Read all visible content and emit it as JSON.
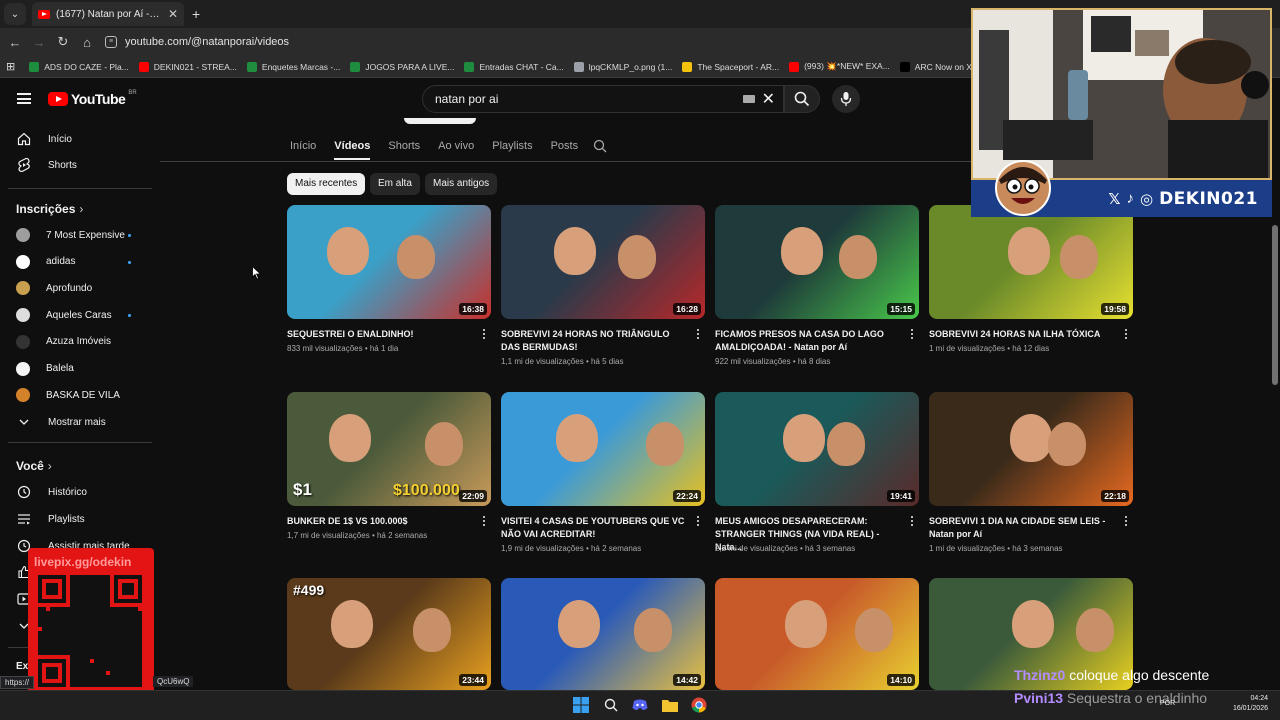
{
  "browser": {
    "tab_title": "(1677) Natan por Aí - YouTube",
    "url": "youtube.com/@natanporai/videos",
    "bookmarks": [
      {
        "label": "ADS DO CAZE - Pla...",
        "color": "#1e8e3e"
      },
      {
        "label": "DEKIN021 - STREA...",
        "color": "#ff0000"
      },
      {
        "label": "Enquetes Marcas -...",
        "color": "#1e8e3e"
      },
      {
        "label": "JOGOS PARA A LIVE...",
        "color": "#1e8e3e"
      },
      {
        "label": "Entradas CHAT - Ca...",
        "color": "#1e8e3e"
      },
      {
        "label": "lpqCKMLP_o.png (1...",
        "color": "#9aa0a6"
      },
      {
        "label": "The Spaceport - AR...",
        "color": "#f4c20d"
      },
      {
        "label": "(993) 💥*NEW* EXA...",
        "color": "#ff0000"
      },
      {
        "label": "ARC Now on X: \"Co...",
        "color": "#000000"
      }
    ]
  },
  "header": {
    "logo_text": "YouTube",
    "logo_region": "BR",
    "search_value": "natan por ai"
  },
  "sidebar": {
    "top_items": [
      {
        "label": "Início",
        "icon": "home-icon"
      },
      {
        "label": "Shorts",
        "icon": "shorts-icon"
      }
    ],
    "subscriptions_heading": "Inscrições",
    "subscriptions": [
      {
        "label": "7 Most Expensive",
        "color": "#9e9e9e",
        "new": true
      },
      {
        "label": "adidas",
        "color": "#ffffff",
        "new": true
      },
      {
        "label": "Aprofundo",
        "color": "#c8a050",
        "new": false
      },
      {
        "label": "Aqueles Caras",
        "color": "#dddddd",
        "new": true
      },
      {
        "label": "Azuza Imóveis",
        "color": "#333333",
        "new": false
      },
      {
        "label": "Balela",
        "color": "#f5f5f5",
        "new": false
      },
      {
        "label": "BASKA DE VILA",
        "color": "#d4822a",
        "new": false
      }
    ],
    "show_more": "Mostrar mais",
    "you_heading": "Você",
    "you_items": [
      {
        "label": "Histórico",
        "icon": "history-icon"
      },
      {
        "label": "Playlists",
        "icon": "playlists-icon"
      },
      {
        "label": "Assistir mais tarde",
        "icon": "watch-later-icon"
      }
    ],
    "bottom_partial": "Ex"
  },
  "channel": {
    "tabs": [
      "Início",
      "Vídeos",
      "Shorts",
      "Ao vivo",
      "Playlists",
      "Posts"
    ],
    "active_tab": "Vídeos",
    "chips": [
      "Mais recentes",
      "Em alta",
      "Mais antigos"
    ],
    "active_chip": "Mais recentes"
  },
  "videos": [
    {
      "title": "SEQUESTREI O ENALDINHO!",
      "views": "833 mil visualizações",
      "age": "há 1 dia",
      "duration": "16:38",
      "colors": [
        "#3aa0c8",
        "#c8302a"
      ]
    },
    {
      "title": "SOBREVIVI 24 HORAS NO TRIÂNGULO DAS BERMUDAS!",
      "views": "1,1 mi de visualizações",
      "age": "há 5 dias",
      "duration": "16:28",
      "colors": [
        "#2a3a4a",
        "#b8282a"
      ]
    },
    {
      "title": "FICAMOS PRESOS NA CASA DO LAGO AMALDIÇOADA! - Natan por Aí",
      "views": "922 mil visualizações",
      "age": "há 8 dias",
      "duration": "15:15",
      "colors": [
        "#1e3a3a",
        "#49c84a"
      ]
    },
    {
      "title": "SOBREVIVI 24 HORAS NA ILHA TÓXICA",
      "views": "1 mi de visualizações",
      "age": "há 12 dias",
      "duration": "19:58",
      "colors": [
        "#6a8a2a",
        "#e8e030"
      ]
    },
    {
      "title": "BUNKER DE 1$ VS 100.000$",
      "views": "1,7 mi de visualizações",
      "age": "há 2 semanas",
      "duration": "22:09",
      "colors": [
        "#4a5a3a",
        "#c89a5a"
      ],
      "label_left": "$1",
      "label_right": "$100.000"
    },
    {
      "title": "VISITEI 4 CASAS DE YOUTUBERS QUE VC NÃO VAI ACREDITAR!",
      "views": "1,9 mi de visualizações",
      "age": "há 2 semanas",
      "duration": "22:24",
      "colors": [
        "#3a9ad8",
        "#e8c020"
      ]
    },
    {
      "title": "MEUS AMIGOS DESAPARECERAM: STRANGER THINGS (NA VIDA REAL) - Nata...",
      "views": "2,2 mi de visualizações",
      "age": "há 3 semanas",
      "duration": "19:41",
      "colors": [
        "#1a5a5a",
        "#5a2a2a"
      ]
    },
    {
      "title": "SOBREVIVI 1 DIA NA CIDADE SEM LEIS - Natan por Aí",
      "views": "1 mi de visualizações",
      "age": "há 3 semanas",
      "duration": "22:18",
      "colors": [
        "#3a2a1a",
        "#e86a20"
      ]
    },
    {
      "title": "",
      "views": "",
      "age": "",
      "duration": "23:44",
      "colors": [
        "#5a3a1a",
        "#e8a020"
      ],
      "label_left": "#499"
    },
    {
      "title": "",
      "views": "",
      "age": "",
      "duration": "14:42",
      "colors": [
        "#2a5ab8",
        "#e8c040"
      ]
    },
    {
      "title": "",
      "views": "",
      "age": "",
      "duration": "14:10",
      "colors": [
        "#c85a2a",
        "#e8d030"
      ]
    },
    {
      "title": "",
      "views": "",
      "age": "",
      "duration": "",
      "colors": [
        "#3a5a3a",
        "#e8d020"
      ]
    }
  ],
  "overlay": {
    "cam_handle": "DEKIN021",
    "qr_text": "livepix.gg/odekin",
    "chat": [
      {
        "user": "Thzinz0",
        "message": "coloque algo descente"
      },
      {
        "user": "Pvini13",
        "message": "Sequestra o enaldinho"
      }
    ],
    "status_url": "https://",
    "status_url_tail": "QcU6wQ"
  },
  "taskbar": {
    "lang": "POR",
    "time": "04:24",
    "date": "16/01/2026"
  }
}
